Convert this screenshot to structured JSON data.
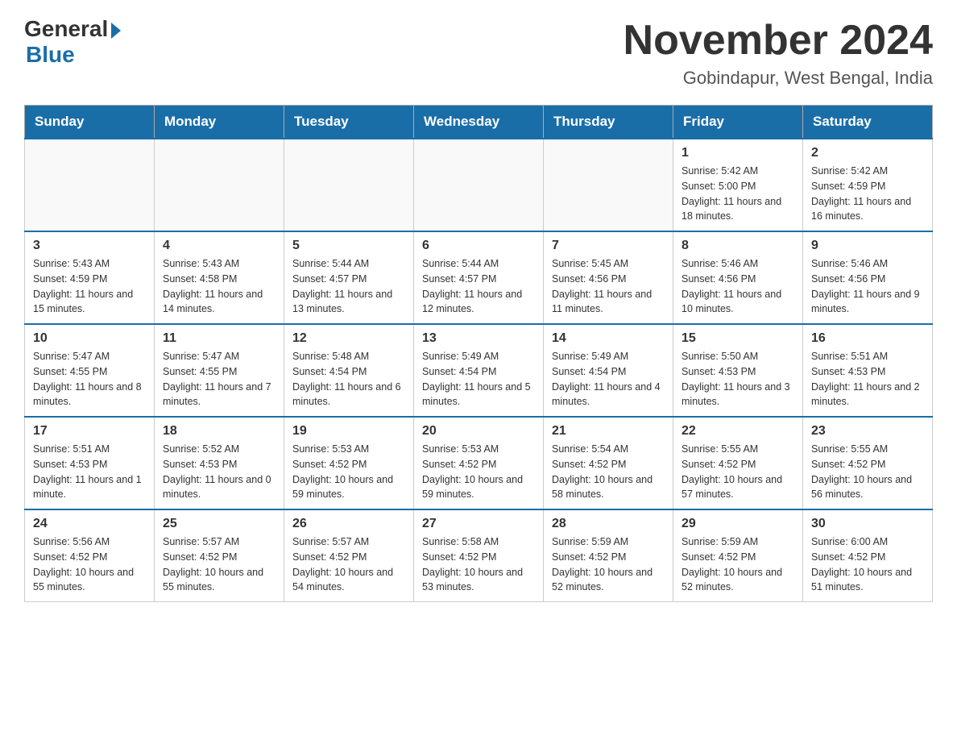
{
  "header": {
    "logo_general": "General",
    "logo_blue": "Blue",
    "month_title": "November 2024",
    "location": "Gobindapur, West Bengal, India"
  },
  "days_of_week": [
    "Sunday",
    "Monday",
    "Tuesday",
    "Wednesday",
    "Thursday",
    "Friday",
    "Saturday"
  ],
  "weeks": [
    [
      {
        "day": "",
        "info": ""
      },
      {
        "day": "",
        "info": ""
      },
      {
        "day": "",
        "info": ""
      },
      {
        "day": "",
        "info": ""
      },
      {
        "day": "",
        "info": ""
      },
      {
        "day": "1",
        "info": "Sunrise: 5:42 AM\nSunset: 5:00 PM\nDaylight: 11 hours and 18 minutes."
      },
      {
        "day": "2",
        "info": "Sunrise: 5:42 AM\nSunset: 4:59 PM\nDaylight: 11 hours and 16 minutes."
      }
    ],
    [
      {
        "day": "3",
        "info": "Sunrise: 5:43 AM\nSunset: 4:59 PM\nDaylight: 11 hours and 15 minutes."
      },
      {
        "day": "4",
        "info": "Sunrise: 5:43 AM\nSunset: 4:58 PM\nDaylight: 11 hours and 14 minutes."
      },
      {
        "day": "5",
        "info": "Sunrise: 5:44 AM\nSunset: 4:57 PM\nDaylight: 11 hours and 13 minutes."
      },
      {
        "day": "6",
        "info": "Sunrise: 5:44 AM\nSunset: 4:57 PM\nDaylight: 11 hours and 12 minutes."
      },
      {
        "day": "7",
        "info": "Sunrise: 5:45 AM\nSunset: 4:56 PM\nDaylight: 11 hours and 11 minutes."
      },
      {
        "day": "8",
        "info": "Sunrise: 5:46 AM\nSunset: 4:56 PM\nDaylight: 11 hours and 10 minutes."
      },
      {
        "day": "9",
        "info": "Sunrise: 5:46 AM\nSunset: 4:56 PM\nDaylight: 11 hours and 9 minutes."
      }
    ],
    [
      {
        "day": "10",
        "info": "Sunrise: 5:47 AM\nSunset: 4:55 PM\nDaylight: 11 hours and 8 minutes."
      },
      {
        "day": "11",
        "info": "Sunrise: 5:47 AM\nSunset: 4:55 PM\nDaylight: 11 hours and 7 minutes."
      },
      {
        "day": "12",
        "info": "Sunrise: 5:48 AM\nSunset: 4:54 PM\nDaylight: 11 hours and 6 minutes."
      },
      {
        "day": "13",
        "info": "Sunrise: 5:49 AM\nSunset: 4:54 PM\nDaylight: 11 hours and 5 minutes."
      },
      {
        "day": "14",
        "info": "Sunrise: 5:49 AM\nSunset: 4:54 PM\nDaylight: 11 hours and 4 minutes."
      },
      {
        "day": "15",
        "info": "Sunrise: 5:50 AM\nSunset: 4:53 PM\nDaylight: 11 hours and 3 minutes."
      },
      {
        "day": "16",
        "info": "Sunrise: 5:51 AM\nSunset: 4:53 PM\nDaylight: 11 hours and 2 minutes."
      }
    ],
    [
      {
        "day": "17",
        "info": "Sunrise: 5:51 AM\nSunset: 4:53 PM\nDaylight: 11 hours and 1 minute."
      },
      {
        "day": "18",
        "info": "Sunrise: 5:52 AM\nSunset: 4:53 PM\nDaylight: 11 hours and 0 minutes."
      },
      {
        "day": "19",
        "info": "Sunrise: 5:53 AM\nSunset: 4:52 PM\nDaylight: 10 hours and 59 minutes."
      },
      {
        "day": "20",
        "info": "Sunrise: 5:53 AM\nSunset: 4:52 PM\nDaylight: 10 hours and 59 minutes."
      },
      {
        "day": "21",
        "info": "Sunrise: 5:54 AM\nSunset: 4:52 PM\nDaylight: 10 hours and 58 minutes."
      },
      {
        "day": "22",
        "info": "Sunrise: 5:55 AM\nSunset: 4:52 PM\nDaylight: 10 hours and 57 minutes."
      },
      {
        "day": "23",
        "info": "Sunrise: 5:55 AM\nSunset: 4:52 PM\nDaylight: 10 hours and 56 minutes."
      }
    ],
    [
      {
        "day": "24",
        "info": "Sunrise: 5:56 AM\nSunset: 4:52 PM\nDaylight: 10 hours and 55 minutes."
      },
      {
        "day": "25",
        "info": "Sunrise: 5:57 AM\nSunset: 4:52 PM\nDaylight: 10 hours and 55 minutes."
      },
      {
        "day": "26",
        "info": "Sunrise: 5:57 AM\nSunset: 4:52 PM\nDaylight: 10 hours and 54 minutes."
      },
      {
        "day": "27",
        "info": "Sunrise: 5:58 AM\nSunset: 4:52 PM\nDaylight: 10 hours and 53 minutes."
      },
      {
        "day": "28",
        "info": "Sunrise: 5:59 AM\nSunset: 4:52 PM\nDaylight: 10 hours and 52 minutes."
      },
      {
        "day": "29",
        "info": "Sunrise: 5:59 AM\nSunset: 4:52 PM\nDaylight: 10 hours and 52 minutes."
      },
      {
        "day": "30",
        "info": "Sunrise: 6:00 AM\nSunset: 4:52 PM\nDaylight: 10 hours and 51 minutes."
      }
    ]
  ]
}
